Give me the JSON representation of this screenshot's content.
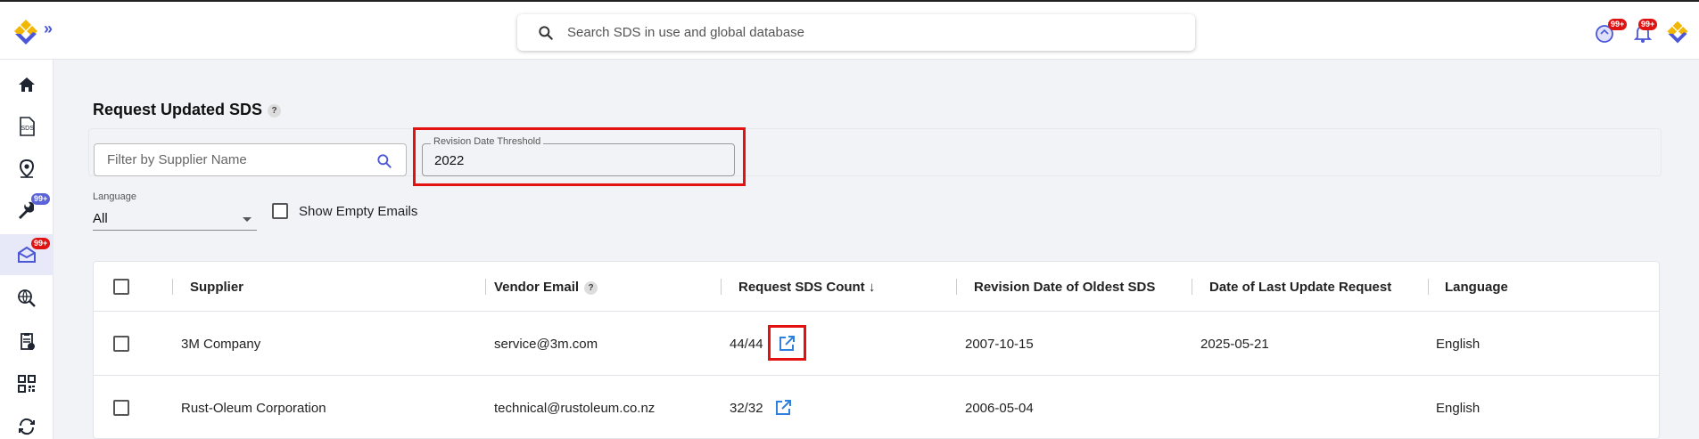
{
  "search": {
    "placeholder": "Search SDS in use and global database"
  },
  "header": {
    "expand_glyph": "»",
    "badge_tasks": "99+",
    "badge_notifications": "99+"
  },
  "sidebar": {
    "items": [
      {
        "name": "home",
        "label": ""
      },
      {
        "name": "sds",
        "label": "SDS"
      },
      {
        "name": "location",
        "label": ""
      },
      {
        "name": "tools",
        "label": "",
        "badge": "99+"
      },
      {
        "name": "request-sds",
        "label": "",
        "badge": "99+",
        "active": true
      },
      {
        "name": "global-search",
        "label": ""
      },
      {
        "name": "clipboard",
        "label": ""
      },
      {
        "name": "qr",
        "label": ""
      },
      {
        "name": "sync",
        "label": ""
      }
    ]
  },
  "page": {
    "title": "Request Updated SDS",
    "title_help": "?"
  },
  "filters": {
    "supplier_placeholder": "Filter by Supplier Name",
    "revision_label": "Revision Date Threshold",
    "revision_value": "2022",
    "language_label": "Language",
    "language_value": "All",
    "show_empty_label": "Show Empty Emails"
  },
  "table": {
    "headers": {
      "supplier": "Supplier",
      "vendor_email": "Vendor Email",
      "vendor_email_help": "?",
      "request_count": "Request SDS Count",
      "sort_arrow": "↓",
      "revision_oldest": "Revision Date of Oldest SDS",
      "last_update": "Date of Last Update Request",
      "language": "Language"
    },
    "rows": [
      {
        "supplier": "3M Company",
        "email": "service@3m.com",
        "count": "44/44",
        "revision": "2007-10-15",
        "last_update": "2025-05-21",
        "language": "English"
      },
      {
        "supplier": "Rust-Oleum Corporation",
        "email": "technical@rustoleum.co.nz",
        "count": "32/32",
        "revision": "2006-05-04",
        "last_update": "",
        "language": "English"
      }
    ]
  },
  "colors": {
    "accent": "#4b57d6",
    "highlight": "#e41111",
    "badge": "#e01313",
    "link": "#2f7fdc"
  }
}
